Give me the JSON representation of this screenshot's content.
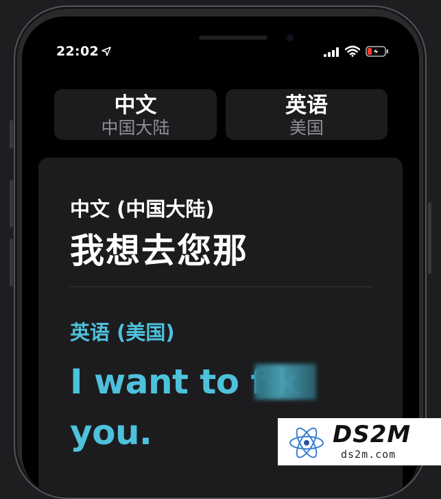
{
  "status_bar": {
    "time": "22:02",
    "icons": [
      "location-arrow-icon",
      "cellular-signal-icon",
      "wifi-icon",
      "battery-low-charging-icon"
    ],
    "battery_color": "#ff3b30"
  },
  "language_selector": {
    "source": {
      "name": "中文",
      "region": "中国大陆"
    },
    "target": {
      "name": "英语",
      "region": "美国"
    }
  },
  "translation": {
    "source_label": "中文 (中国大陆)",
    "source_text": "我想去您那",
    "target_label": "英语 (美国)",
    "target_text": "I want to f      k you.",
    "target_color": "#4ec1dc"
  },
  "watermark": {
    "title": "DS2M",
    "url": "ds2m.com"
  }
}
